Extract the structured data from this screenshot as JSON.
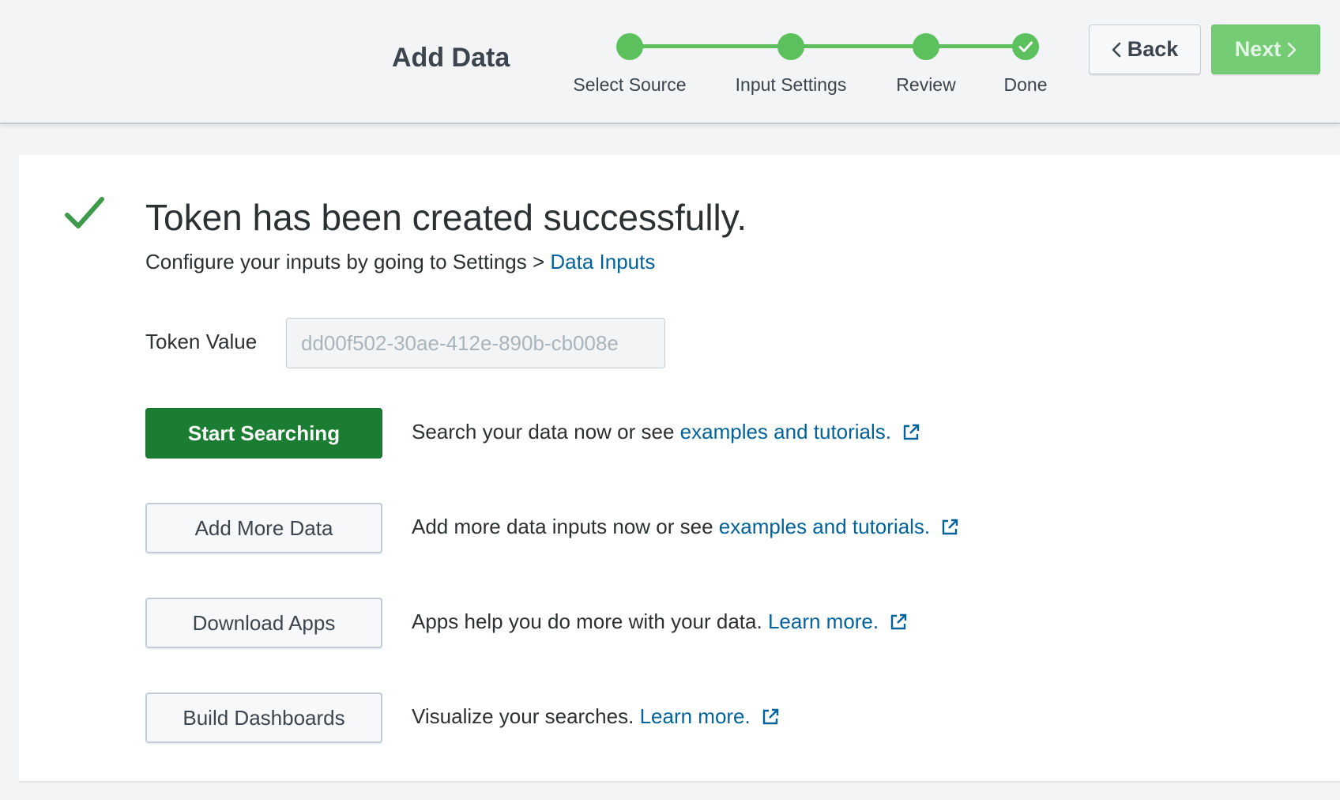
{
  "header": {
    "title": "Add Data",
    "back_label": "Back",
    "next_label": "Next",
    "steps": [
      {
        "label": "Select Source"
      },
      {
        "label": "Input Settings"
      },
      {
        "label": "Review"
      },
      {
        "label": "Done"
      }
    ]
  },
  "success": {
    "title": "Token has been created successfully.",
    "subtitle_prefix": "Configure your inputs by going to Settings > ",
    "subtitle_link": "Data Inputs"
  },
  "token": {
    "label": "Token Value",
    "value": "dd00f502-30ae-412e-890b-cb008e"
  },
  "actions": [
    {
      "button": "Start Searching",
      "text": "Search your data now or see ",
      "link": "examples and tutorials."
    },
    {
      "button": "Add More Data",
      "text": "Add more data inputs now or see ",
      "link": "examples and tutorials."
    },
    {
      "button": "Download Apps",
      "text": "Apps help you do more with your data. ",
      "link": "Learn more."
    },
    {
      "button": "Build Dashboards",
      "text": "Visualize your searches. ",
      "link": "Learn more."
    }
  ],
  "colors": {
    "accent_green": "#5cc05c",
    "primary_button": "#1a7d32",
    "link": "#00639c"
  },
  "icons": {
    "step_done": "check-icon",
    "success": "check-icon",
    "external_link": "external-link-icon",
    "back": "chevron-left-icon",
    "next": "chevron-right-icon"
  }
}
